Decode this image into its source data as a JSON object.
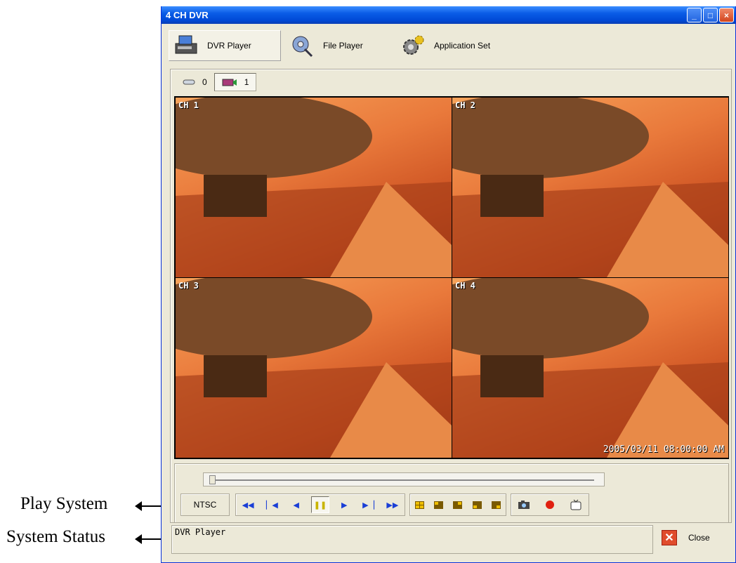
{
  "window": {
    "title": "4 CH DVR"
  },
  "toptabs": [
    {
      "label": "DVR Player"
    },
    {
      "label": "File Player"
    },
    {
      "label": "Application Set"
    }
  ],
  "counters": {
    "hdd_count": "0",
    "camera_count": "1"
  },
  "video": {
    "channels": [
      "CH 1",
      "CH 2",
      "CH 3",
      "CH 4"
    ],
    "timestamp": "2005/03/11 08:00:00 AM"
  },
  "controls": {
    "play_system": "NTSC",
    "playback_buttons": [
      "rewind-fast",
      "skip-start",
      "step-back",
      "pause",
      "play",
      "skip-end",
      "fast-forward"
    ],
    "playback_progress": 0,
    "layout_buttons": 5,
    "extra_buttons": [
      "snapshot",
      "record",
      "tv-out"
    ]
  },
  "status": {
    "text": "DVR Player"
  },
  "close_label": "Close",
  "annotations": {
    "play_system": "Play System",
    "system_status": "System Status"
  },
  "colors": {
    "titlebar": "#0a5ce6",
    "window_bg": "#ece9d8",
    "video_tone": "#e9793b"
  }
}
